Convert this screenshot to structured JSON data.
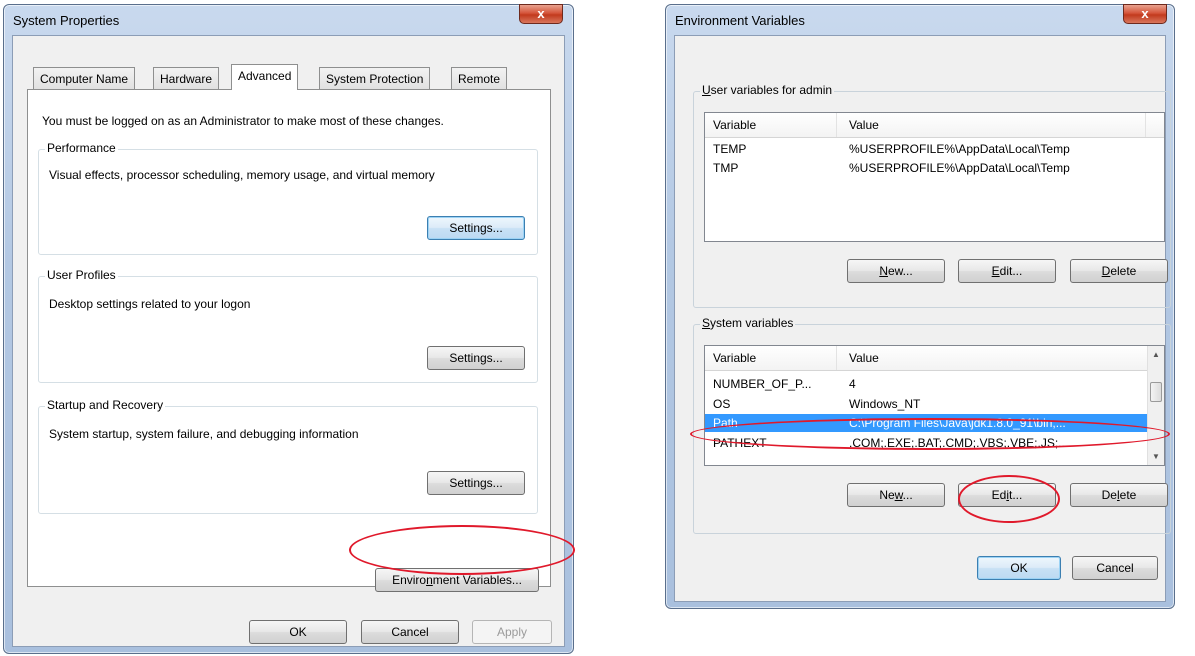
{
  "system_properties": {
    "title": "System Properties",
    "close_glyph": "x",
    "tabs": [
      {
        "label": "Computer Name"
      },
      {
        "label": "Hardware"
      },
      {
        "label": "Advanced"
      },
      {
        "label": "System Protection"
      },
      {
        "label": "Remote"
      }
    ],
    "active_tab": "Advanced",
    "admin_notice": "You must be logged on as an Administrator to make most of these changes.",
    "performance": {
      "label": "Performance",
      "description": "Visual effects, processor scheduling, memory usage, and virtual memory",
      "button": "Settings..."
    },
    "user_profiles": {
      "label": "User Profiles",
      "description": "Desktop settings related to your logon",
      "button": "Settings..."
    },
    "startup_recovery": {
      "label": "Startup and Recovery",
      "description": "System startup, system failure, and debugging information",
      "button": "Settings..."
    },
    "env_button": "Environment Variables...",
    "ok": "OK",
    "cancel": "Cancel",
    "apply": "Apply"
  },
  "environment_variables": {
    "title": "Environment Variables",
    "close_glyph": "x",
    "user_group_label": "User variables for admin",
    "user_columns": [
      "Variable",
      "Value"
    ],
    "user_rows": [
      {
        "variable": "TEMP",
        "value": "%USERPROFILE%\\AppData\\Local\\Temp"
      },
      {
        "variable": "TMP",
        "value": "%USERPROFILE%\\AppData\\Local\\Temp"
      }
    ],
    "user_new": "New...",
    "user_edit": "Edit...",
    "user_delete": "Delete",
    "system_group_label": "System variables",
    "system_columns": [
      "Variable",
      "Value"
    ],
    "system_rows": [
      {
        "variable": "NUMBER_OF_P...",
        "value": "4"
      },
      {
        "variable": "OS",
        "value": "Windows_NT"
      },
      {
        "variable": "Path",
        "value": "C:\\Program Files\\Java\\jdk1.8.0_91\\bin;..."
      },
      {
        "variable": "PATHEXT",
        "value": ".COM;.EXE;.BAT;.CMD;.VBS;.VBE;.JS;...."
      }
    ],
    "selected_system_row": "Path",
    "system_new": "New...",
    "system_edit": "Edit...",
    "system_delete": "Delete",
    "ok": "OK",
    "cancel": "Cancel"
  },
  "colors": {
    "highlight_ellipse": "#e0192b",
    "selection": "#3399ff"
  }
}
